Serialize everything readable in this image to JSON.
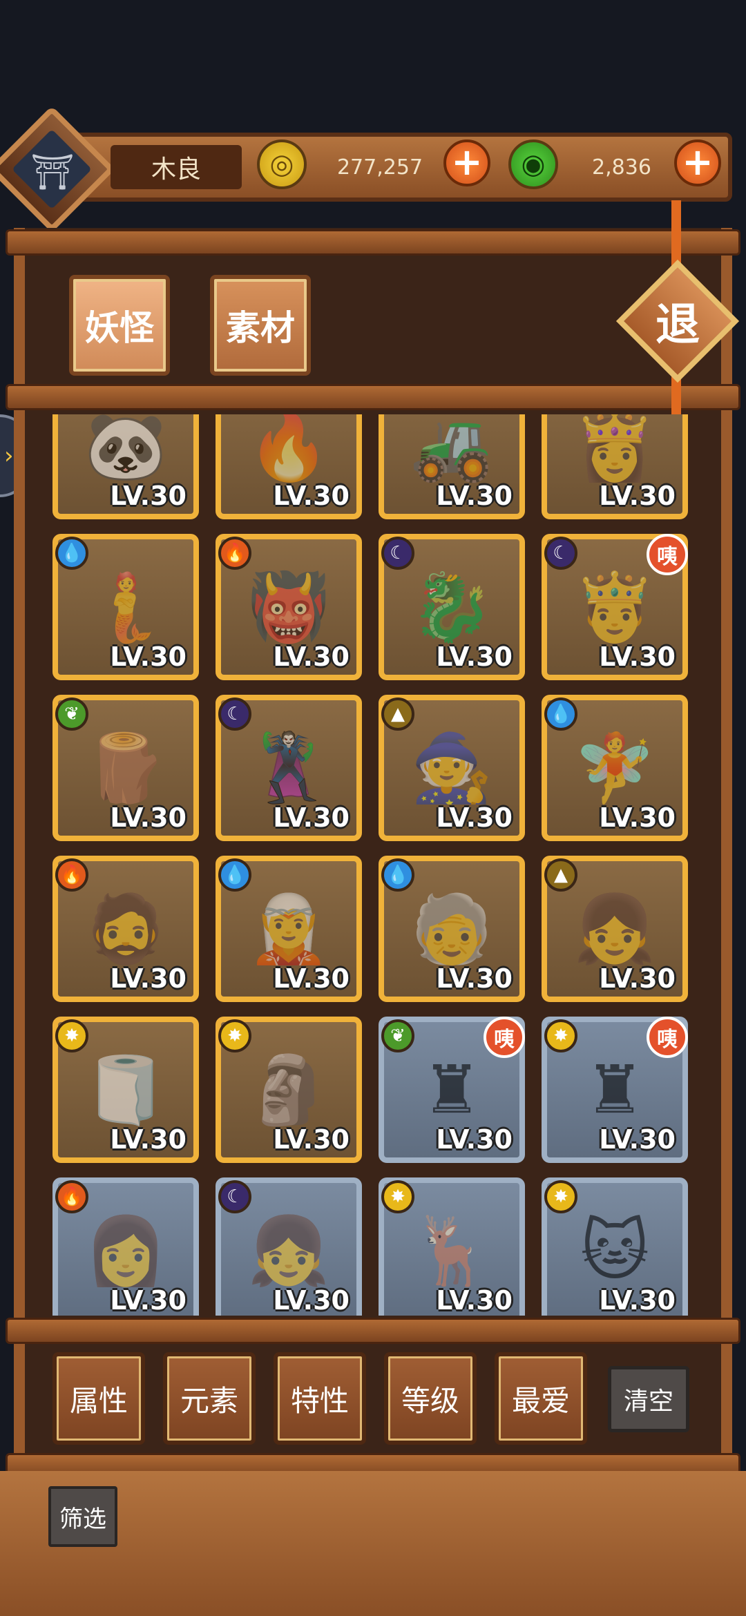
{
  "header": {
    "player_name": "木良",
    "coins": "277,257",
    "jade": "2,836",
    "plus": "+",
    "coin_glyph": "◎",
    "jade_glyph": "◉",
    "avatar_glyph": "⛩"
  },
  "tabs": [
    "妖怪",
    "素材"
  ],
  "exit_label": "退",
  "side_arrow": "›",
  "level_label": "LV.30",
  "badge_label": "咦",
  "element_glyphs": {
    "water": "💧",
    "fire": "🔥",
    "dark": "☾",
    "wood": "❦",
    "earth": "▲",
    "light": "✸"
  },
  "element_colors": {
    "water": "#2f8fe0",
    "fire": "#e25a1c",
    "dark": "#3a2a6a",
    "wood": "#4c9a2a",
    "earth": "#8a6a1a",
    "light": "#e8b81a"
  },
  "cards": [
    {
      "frame": "gold",
      "element": "",
      "badge": false,
      "art": "🐼"
    },
    {
      "frame": "gold",
      "element": "",
      "badge": false,
      "art": "🔥"
    },
    {
      "frame": "gold",
      "element": "",
      "badge": false,
      "art": "🚜"
    },
    {
      "frame": "gold",
      "element": "",
      "badge": false,
      "art": "👸"
    },
    {
      "frame": "gold",
      "element": "water",
      "badge": false,
      "art": "🧜"
    },
    {
      "frame": "gold",
      "element": "fire",
      "badge": false,
      "art": "👹"
    },
    {
      "frame": "gold",
      "element": "dark",
      "badge": false,
      "art": "🐉"
    },
    {
      "frame": "gold",
      "element": "dark",
      "badge": true,
      "art": "🤴"
    },
    {
      "frame": "gold",
      "element": "wood",
      "badge": false,
      "art": "🪵"
    },
    {
      "frame": "gold",
      "element": "dark",
      "badge": false,
      "art": "🦹"
    },
    {
      "frame": "gold",
      "element": "earth",
      "badge": false,
      "art": "🧙"
    },
    {
      "frame": "gold",
      "element": "water",
      "badge": false,
      "art": "🧚"
    },
    {
      "frame": "gold",
      "element": "fire",
      "badge": false,
      "art": "🧔"
    },
    {
      "frame": "gold",
      "element": "water",
      "badge": false,
      "art": "🧝"
    },
    {
      "frame": "gold",
      "element": "water",
      "badge": false,
      "art": "🧓"
    },
    {
      "frame": "gold",
      "element": "earth",
      "badge": false,
      "art": "👧"
    },
    {
      "frame": "gold",
      "element": "light",
      "badge": false,
      "art": "🧻"
    },
    {
      "frame": "gold",
      "element": "light",
      "badge": false,
      "art": "🗿"
    },
    {
      "frame": "silver",
      "element": "wood",
      "badge": true,
      "art": "♜"
    },
    {
      "frame": "silver",
      "element": "light",
      "badge": true,
      "art": "♜"
    },
    {
      "frame": "silver",
      "element": "fire",
      "badge": false,
      "art": "👩"
    },
    {
      "frame": "silver",
      "element": "dark",
      "badge": false,
      "art": "👧"
    },
    {
      "frame": "silver",
      "element": "light",
      "badge": false,
      "art": "🦌"
    },
    {
      "frame": "silver",
      "element": "light",
      "badge": false,
      "art": "🐱"
    }
  ],
  "filters": [
    "属性",
    "元素",
    "特性",
    "等级",
    "最爱"
  ],
  "clear_label": "清空",
  "screen_label": "筛选"
}
